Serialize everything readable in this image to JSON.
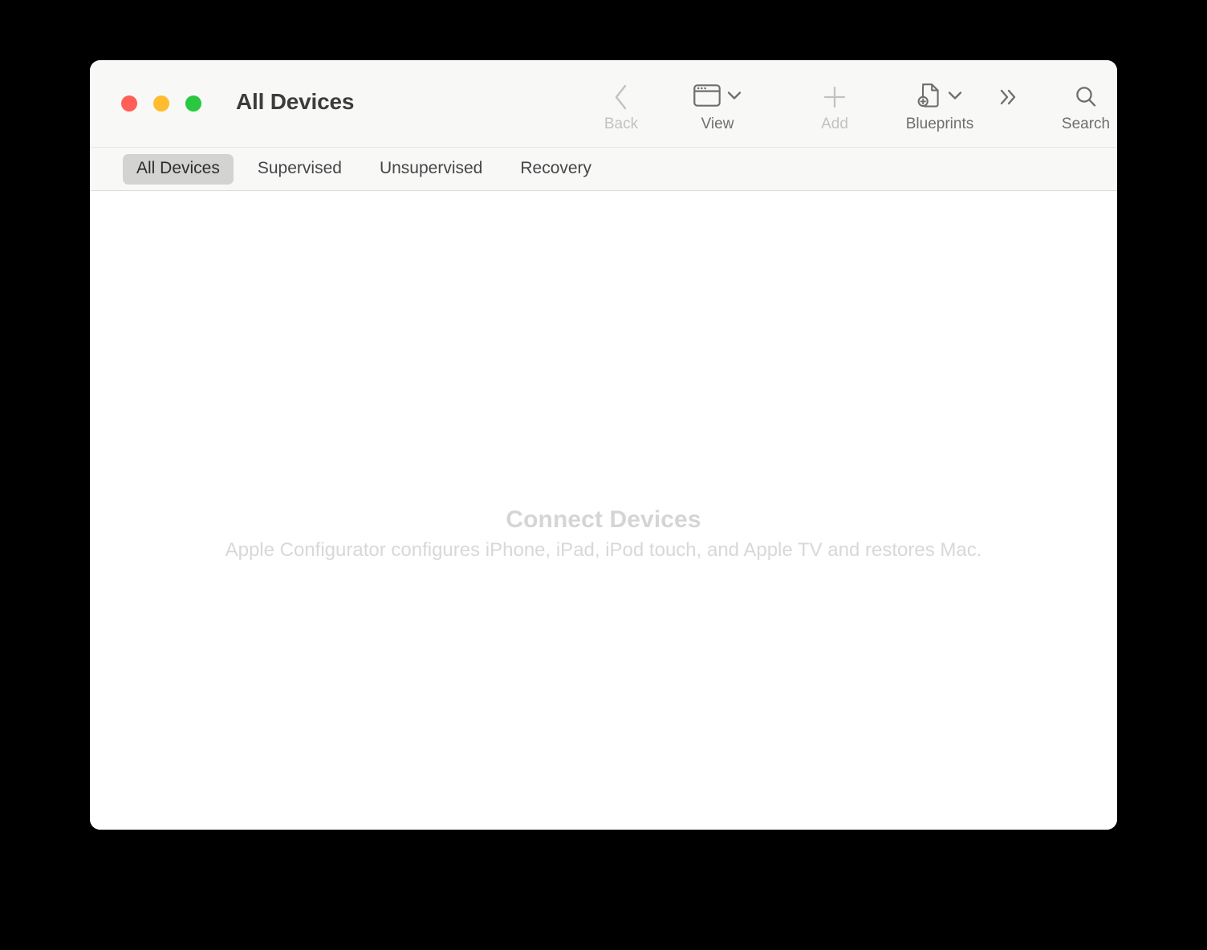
{
  "window": {
    "title": "All Devices",
    "traffic_lights": [
      {
        "name": "close",
        "color": "#ff5f57"
      },
      {
        "name": "minimize",
        "color": "#febc2e"
      },
      {
        "name": "maximize",
        "color": "#2ac840"
      }
    ]
  },
  "toolbar": {
    "items": [
      {
        "name": "back",
        "label": "Back",
        "icon": "chevron-left-icon",
        "enabled": false,
        "has_menu": false
      },
      {
        "name": "view",
        "label": "View",
        "icon": "window-view-icon",
        "enabled": true,
        "has_menu": true
      },
      {
        "name": "add",
        "label": "Add",
        "icon": "plus-icon",
        "enabled": false,
        "has_menu": false
      },
      {
        "name": "blueprints",
        "label": "Blueprints",
        "icon": "document-add-icon",
        "enabled": true,
        "has_menu": true
      },
      {
        "name": "more",
        "label": "",
        "icon": "chevron-double-right-icon",
        "enabled": true,
        "has_menu": false
      },
      {
        "name": "search",
        "label": "Search",
        "icon": "search-icon",
        "enabled": true,
        "has_menu": false
      }
    ]
  },
  "tabs": [
    {
      "label": "All Devices",
      "active": true
    },
    {
      "label": "Supervised",
      "active": false
    },
    {
      "label": "Unsupervised",
      "active": false
    },
    {
      "label": "Recovery",
      "active": false
    }
  ],
  "empty_state": {
    "title": "Connect Devices",
    "subtitle": "Apple Configurator configures iPhone, iPad, iPod touch, and Apple TV and restores Mac."
  },
  "colors": {
    "desktop_background": "#000000",
    "chrome_background": "#f8f8f6",
    "content_background": "#ffffff",
    "active_tab_pill": "#d3d3d1",
    "icon_enabled": "#6e6e6c",
    "icon_disabled": "#c2c2c0",
    "empty_text": "#d5d5d5",
    "title_text": "#3c3c3b"
  }
}
